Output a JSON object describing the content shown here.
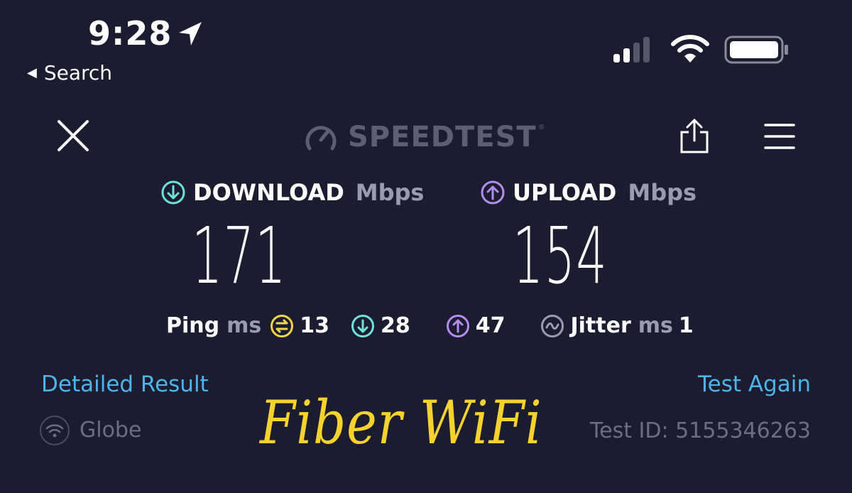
{
  "status_bar": {
    "time": "9:28",
    "back_label": "Search"
  },
  "toolbar": {
    "brand": "SPEEDTEST",
    "brand_tm": "®"
  },
  "download": {
    "label": "DOWNLOAD",
    "unit": "Mbps",
    "value": "171"
  },
  "upload": {
    "label": "UPLOAD",
    "unit": "Mbps",
    "value": "154"
  },
  "ping": {
    "label": "Ping",
    "unit": "ms",
    "idle": "13",
    "download": "28",
    "upload": "47"
  },
  "jitter": {
    "label": "Jitter",
    "unit": "ms",
    "value": "1"
  },
  "actions": {
    "detailed": "Detailed Result",
    "again": "Test Again"
  },
  "provider": "Globe",
  "test_id": "Test ID: 5155346263",
  "overlay_text": "Fiber WiFi",
  "colors": {
    "background": "#1b1c30",
    "download_accent": "#6fe1d9",
    "upload_accent": "#b48cf0",
    "ping_accent": "#f2d34a",
    "link": "#4db3e9",
    "overlay": "#f6d22f"
  }
}
